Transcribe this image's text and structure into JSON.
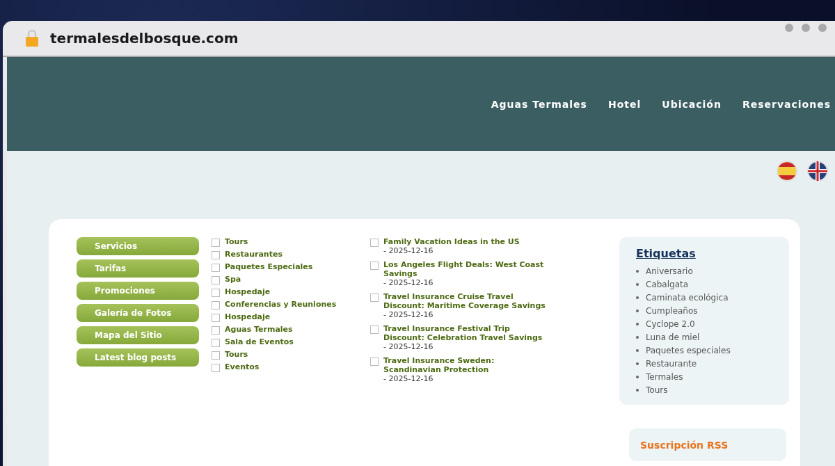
{
  "browser": {
    "address": "termalesdelbosque.com"
  },
  "nav": {
    "items": [
      "Aguas Termales",
      "Hotel",
      "Ubicación",
      "Reservaciones"
    ]
  },
  "languages": [
    {
      "kind": "spain"
    },
    {
      "kind": "uk"
    }
  ],
  "sidebar": {
    "buttons": [
      "Servicios",
      "Tarifas",
      "Promociones",
      "Galería de Fotos",
      "Mapa del Sitio",
      "Latest blog posts"
    ],
    "menu_items": [
      {
        "label": "Tours",
        "checked": false
      },
      {
        "label": "Restaurantes",
        "checked": false
      },
      {
        "label": "Paquetes Especiales",
        "checked": false
      },
      {
        "label": "Spa",
        "checked": false
      },
      {
        "label": "Hospedaje",
        "checked": false
      },
      {
        "label": "Conferencias y Reuniones",
        "checked": false
      },
      {
        "label": "Hospedaje",
        "checked": false
      },
      {
        "label": "Aguas Termales",
        "checked": false
      },
      {
        "label": "Sala de Eventos",
        "checked": false
      },
      {
        "label": "Tours",
        "checked": false
      },
      {
        "label": "Eventos",
        "checked": false
      }
    ],
    "blog_posts": [
      {
        "title": "Family Vacation Ideas in the US",
        "date": "- 2025-12-16",
        "checked": false
      },
      {
        "title": "Los Angeles Flight Deals: West Coast Savings",
        "date": "- 2025-12-16",
        "checked": false
      },
      {
        "title": "Travel Insurance Cruise Travel Discount: Maritime Coverage Savings",
        "date": "- 2025-12-16",
        "checked": false
      },
      {
        "title": "Travel Insurance Festival Trip Discount: Celebration Travel Savings",
        "date": "- 2025-12-16",
        "checked": false
      },
      {
        "title": "Travel Insurance Sweden: Scandinavian Protection",
        "date": "- 2025-12-16",
        "checked": false
      }
    ]
  },
  "tags": {
    "title": "Etiquetas",
    "items": [
      "Aniversario",
      "Cabalgata",
      "Caminata ecológica",
      "Cumpleaños",
      "Cyclope 2.0",
      "Luna de miel",
      "Paquetes especiales",
      "Restaurante",
      "Termales",
      "Tours"
    ]
  },
  "rss": {
    "title": "Suscripción RSS"
  }
}
